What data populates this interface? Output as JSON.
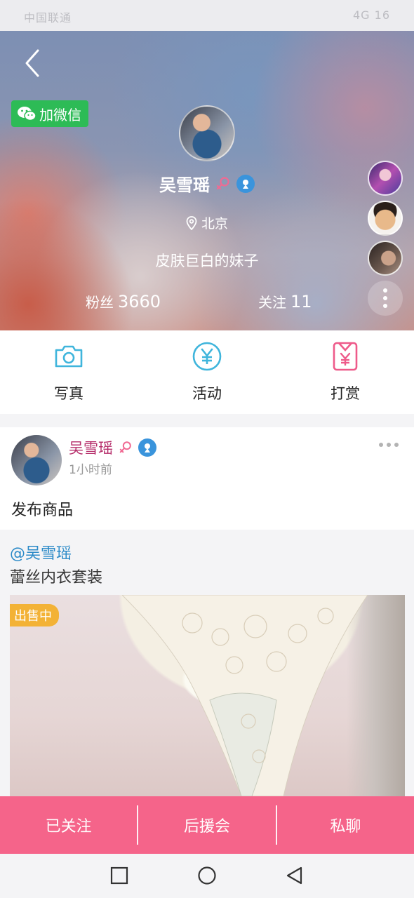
{
  "status_bar": {
    "left_text": "中国联通",
    "right_text": "4G 16"
  },
  "header": {
    "wechat_label": "加微信",
    "name": "吴雪瑶",
    "location": "北京",
    "bio": "皮肤巨白的妹子",
    "fans_label": "粉丝",
    "fans_count": "3660",
    "follows_label": "关注",
    "follows_count": "11"
  },
  "quick_menu": [
    {
      "label": "写真",
      "icon": "camera-icon"
    },
    {
      "label": "活动",
      "icon": "yen-circle-icon"
    },
    {
      "label": "打赏",
      "icon": "reward-icon"
    }
  ],
  "post": {
    "author": "吴雪瑶",
    "time": "1小时前",
    "text": "发布商品"
  },
  "product": {
    "mention": "@吴雪瑶",
    "title": "蕾丝内衣套装",
    "badge": "出售中"
  },
  "action_bar": {
    "followed": "已关注",
    "support": "后援会",
    "chat": "私聊"
  },
  "colors": {
    "wechat_green": "#2dbb56",
    "accent_pink": "#f5648a",
    "icon_blue": "#3fb5dc",
    "mention_blue": "#2b8ac8",
    "badge_orange": "#f3b236"
  }
}
